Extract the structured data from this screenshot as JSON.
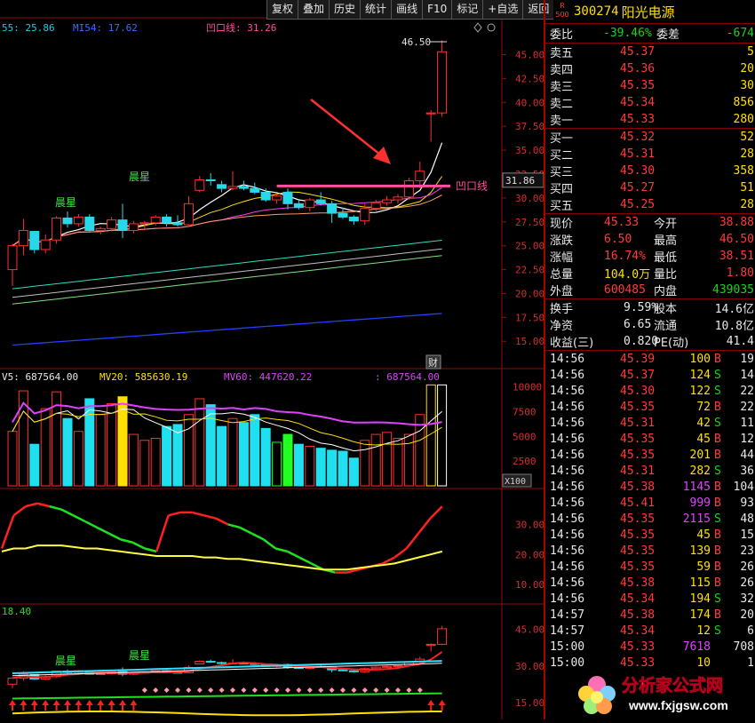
{
  "toolbar": {
    "buttons": [
      "复权",
      "叠加",
      "历史",
      "统计",
      "画线",
      "F10",
      "标记",
      "+自选",
      "返回"
    ]
  },
  "main_panel": {
    "ma_legend": [
      {
        "text": "55: 25.86",
        "color": "#28c8e0"
      },
      {
        "text": "MI54: 17.62",
        "color": "#3a6cff"
      },
      {
        "text": "凹口线: 31.26",
        "color": "#ff4fa0"
      }
    ],
    "high_label": "46.50",
    "current_price_tag": "31.86",
    "line_label": "凹口线",
    "morning_star_label": "晨星",
    "fin_label": "财",
    "y_ticks": [
      "45.00",
      "42.50",
      "40.00",
      "37.50",
      "35.00",
      "32.50",
      "30.00",
      "27.50",
      "25.00",
      "22.50",
      "20.00",
      "17.50",
      "15.00"
    ]
  },
  "volume_panel": {
    "legend": [
      {
        "text": "V5: 687564.00",
        "color": "#e8e8e8"
      },
      {
        "text": "MV20: 585630.19",
        "color": "#ffe000"
      },
      {
        "text": "MV60: 447620.22",
        "color": "#e040ff"
      },
      {
        "text": ": 687564.00",
        "color": "#e040ff"
      }
    ],
    "y_ticks": [
      "10000",
      "7500",
      "5000",
      "2500"
    ],
    "unit_label": "X100"
  },
  "indicator_panel": {
    "y_ticks": [
      "30.00",
      "20.00",
      "10.00"
    ]
  },
  "bottom_panel": {
    "value_label": "18.40",
    "y_ticks": [
      "45.00",
      "30.00",
      "15.00"
    ],
    "morning_star_label": "晨星"
  },
  "stock": {
    "code": "300274",
    "name": "阳光电源",
    "icon_text_top": "R",
    "icon_text_bottom": "500"
  },
  "quote_ratio": {
    "wei_bi_label": "委比",
    "wei_bi": "-39.46%",
    "wei_cha_label": "委差",
    "wei_cha": "-674"
  },
  "sell_orders": [
    {
      "label": "卖五",
      "price": "45.37",
      "volume": "5"
    },
    {
      "label": "卖四",
      "price": "45.36",
      "volume": "20"
    },
    {
      "label": "卖三",
      "price": "45.35",
      "volume": "30"
    },
    {
      "label": "卖二",
      "price": "45.34",
      "volume": "856"
    },
    {
      "label": "卖一",
      "price": "45.33",
      "volume": "280"
    }
  ],
  "buy_orders": [
    {
      "label": "买一",
      "price": "45.32",
      "volume": "52"
    },
    {
      "label": "买二",
      "price": "45.31",
      "volume": "28"
    },
    {
      "label": "买三",
      "price": "45.30",
      "volume": "358"
    },
    {
      "label": "买四",
      "price": "45.27",
      "volume": "51"
    },
    {
      "label": "买五",
      "price": "45.25",
      "volume": "28"
    }
  ],
  "stats": [
    {
      "l1": "现价",
      "v1": "45.33",
      "c1": "red",
      "l2": "今开",
      "v2": "38.88",
      "c2": "red"
    },
    {
      "l1": "涨跌",
      "v1": "6.50",
      "c1": "red",
      "l2": "最高",
      "v2": "46.50",
      "c2": "red"
    },
    {
      "l1": "涨幅",
      "v1": "16.74%",
      "c1": "red",
      "l2": "最低",
      "v2": "38.51",
      "c2": "red"
    },
    {
      "l1": "总量",
      "v1": "104.0万",
      "c1": "yellow",
      "l2": "量比",
      "v2": "1.80",
      "c2": "red"
    },
    {
      "l1": "外盘",
      "v1": "600485",
      "c1": "red",
      "l2": "内盘",
      "v2": "439035",
      "c2": "green"
    }
  ],
  "fundamentals": [
    {
      "l1": "换手",
      "v1": "9.59%",
      "l2": "股本",
      "v2": "14.6亿"
    },
    {
      "l1": "净资",
      "v1": "6.65",
      "l2": "流通",
      "v2": "10.8亿"
    },
    {
      "l1": "收益(三)",
      "v1": "0.820",
      "l2": "PE(动)",
      "v2": "41.4"
    }
  ],
  "ticks": [
    {
      "time": "14:56",
      "price": "45.39",
      "vol": "100",
      "bs": "B",
      "n": "19"
    },
    {
      "time": "14:56",
      "price": "45.37",
      "vol": "124",
      "bs": "S",
      "n": "14"
    },
    {
      "time": "14:56",
      "price": "45.30",
      "vol": "122",
      "bs": "S",
      "n": "22"
    },
    {
      "time": "14:56",
      "price": "45.35",
      "vol": "72",
      "bs": "B",
      "n": "22"
    },
    {
      "time": "14:56",
      "price": "45.31",
      "vol": "42",
      "bs": "S",
      "n": "11"
    },
    {
      "time": "14:56",
      "price": "45.35",
      "vol": "45",
      "bs": "B",
      "n": "12"
    },
    {
      "time": "14:56",
      "price": "45.35",
      "vol": "201",
      "bs": "B",
      "n": "44"
    },
    {
      "time": "14:56",
      "price": "45.31",
      "vol": "282",
      "bs": "S",
      "n": "36"
    },
    {
      "time": "14:56",
      "price": "45.38",
      "vol": "1145",
      "bs": "B",
      "n": "104"
    },
    {
      "time": "14:56",
      "price": "45.41",
      "vol": "999",
      "bs": "B",
      "n": "93"
    },
    {
      "time": "14:56",
      "price": "45.35",
      "vol": "2115",
      "bs": "S",
      "n": "48"
    },
    {
      "time": "14:56",
      "price": "45.35",
      "vol": "45",
      "bs": "B",
      "n": "15"
    },
    {
      "time": "14:56",
      "price": "45.35",
      "vol": "139",
      "bs": "B",
      "n": "23"
    },
    {
      "time": "14:56",
      "price": "45.35",
      "vol": "59",
      "bs": "B",
      "n": "26"
    },
    {
      "time": "14:56",
      "price": "45.38",
      "vol": "115",
      "bs": "B",
      "n": "26"
    },
    {
      "time": "14:56",
      "price": "45.34",
      "vol": "194",
      "bs": "S",
      "n": "32"
    },
    {
      "time": "14:57",
      "price": "45.38",
      "vol": "174",
      "bs": "B",
      "n": "20"
    },
    {
      "time": "14:57",
      "price": "45.34",
      "vol": "12",
      "bs": "S",
      "n": "6"
    },
    {
      "time": "15:00",
      "price": "45.33",
      "vol": "7618",
      "bs": "",
      "n": "708"
    },
    {
      "time": "15:00",
      "price": "45.33",
      "vol": "10",
      "bs": "",
      "n": "1"
    }
  ],
  "watermark": {
    "title": "分析家公式网",
    "url": "www.fxjgsw.com"
  },
  "chart_data": {
    "type": "candlestick",
    "ylim": [
      14,
      47
    ],
    "candles": [
      [
        22.5,
        25.2,
        20.8,
        25.0
      ],
      [
        25.0,
        27.8,
        24.0,
        26.6
      ],
      [
        26.5,
        26.5,
        24.2,
        24.6
      ],
      [
        24.6,
        26.2,
        24.2,
        25.6
      ],
      [
        25.6,
        28.1,
        25.2,
        27.9
      ],
      [
        27.9,
        28.6,
        26.9,
        27.3
      ],
      [
        27.3,
        28.3,
        27.0,
        28.0
      ],
      [
        28.0,
        28.3,
        26.4,
        26.6
      ],
      [
        26.6,
        27.0,
        26.2,
        26.8
      ],
      [
        26.8,
        28.0,
        26.5,
        27.7
      ],
      [
        27.7,
        29.4,
        25.8,
        26.6
      ],
      [
        26.6,
        27.6,
        26.3,
        27.3
      ],
      [
        27.3,
        27.6,
        26.8,
        27.4
      ],
      [
        27.4,
        28.2,
        27.1,
        28.0
      ],
      [
        28.0,
        28.3,
        27.0,
        27.4
      ],
      [
        27.4,
        28.2,
        27.0,
        27.2
      ],
      [
        27.2,
        30.2,
        27.0,
        29.4
      ],
      [
        30.8,
        32.3,
        30.6,
        31.9
      ],
      [
        31.9,
        32.6,
        31.3,
        31.8
      ],
      [
        31.4,
        31.8,
        30.6,
        31.0
      ],
      [
        31.0,
        32.8,
        30.8,
        31.2
      ],
      [
        31.2,
        31.8,
        30.8,
        31.0
      ],
      [
        31.0,
        31.6,
        30.4,
        30.6
      ],
      [
        30.6,
        31.0,
        29.6,
        29.8
      ],
      [
        29.8,
        30.5,
        29.4,
        30.2
      ],
      [
        30.6,
        31.0,
        28.8,
        29.4
      ],
      [
        29.4,
        29.8,
        28.8,
        29.0
      ],
      [
        29.0,
        30.0,
        28.6,
        29.8
      ],
      [
        29.8,
        30.6,
        29.2,
        29.4
      ],
      [
        29.4,
        29.7,
        27.4,
        28.4
      ],
      [
        28.4,
        29.0,
        27.8,
        28.0
      ],
      [
        28.0,
        28.2,
        27.2,
        27.6
      ],
      [
        27.6,
        29.4,
        27.2,
        28.9
      ],
      [
        28.9,
        29.8,
        28.6,
        29.5
      ],
      [
        29.5,
        30.2,
        29.2,
        29.8
      ],
      [
        29.8,
        30.4,
        29.4,
        30.1
      ],
      [
        30.1,
        32.1,
        29.8,
        31.8
      ],
      [
        31.8,
        33.8,
        31.0,
        32.8
      ],
      [
        38.8,
        39.2,
        35.9,
        38.9
      ],
      [
        38.9,
        46.5,
        38.5,
        45.3
      ]
    ],
    "volume": [
      55,
      96,
      42,
      78,
      95,
      68,
      55,
      88,
      72,
      83,
      90,
      52,
      46,
      48,
      60,
      62,
      72,
      88,
      82,
      60,
      68,
      64,
      72,
      58,
      44,
      52,
      42,
      40,
      38,
      36,
      35,
      28,
      46,
      52,
      54,
      48,
      52,
      72,
      102,
      102
    ],
    "indicator": {
      "red": [
        22,
        33,
        36,
        37,
        36,
        35,
        33,
        31,
        29,
        27,
        25,
        24,
        22,
        21,
        33,
        34,
        34,
        33,
        32,
        30,
        29,
        27,
        25,
        22,
        21,
        19,
        17,
        15,
        14,
        14,
        15,
        16,
        17,
        19,
        22,
        27,
        32,
        36
      ],
      "yellow": [
        21,
        22,
        22,
        23,
        23,
        23,
        22.5,
        22,
        22,
        21.5,
        21,
        20.5,
        20,
        19.5,
        19.5,
        19.5,
        19.5,
        19,
        19,
        18.5,
        18.5,
        18,
        17.5,
        17,
        16.5,
        16,
        15.5,
        15,
        15,
        15,
        15.5,
        16,
        16.5,
        17,
        18,
        19,
        20,
        21
      ]
    }
  }
}
